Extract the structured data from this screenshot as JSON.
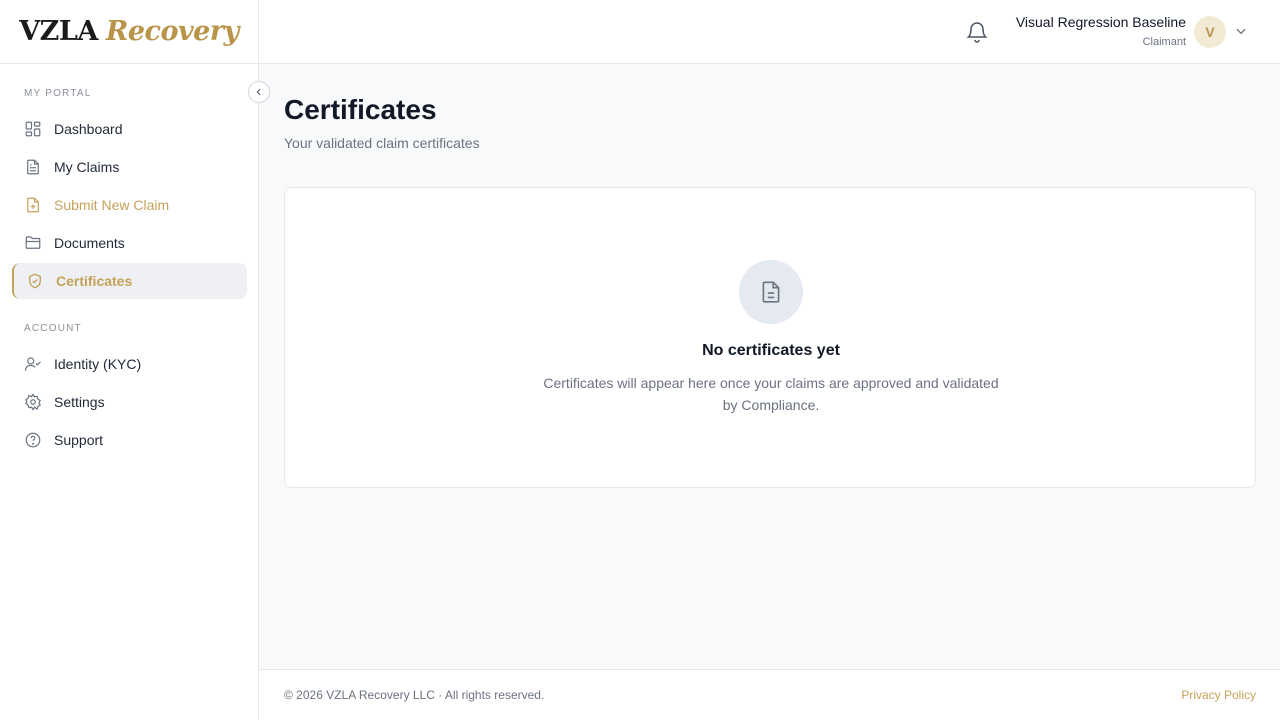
{
  "brand": {
    "part1": "VZLA",
    "part2": "Recovery"
  },
  "sidebar": {
    "section_portal": "MY PORTAL",
    "section_account": "ACCOUNT",
    "items": [
      {
        "label": "Dashboard",
        "icon": "grid-icon"
      },
      {
        "label": "My Claims",
        "icon": "document-icon"
      },
      {
        "label": "Submit New Claim",
        "icon": "file-plus-icon"
      },
      {
        "label": "Documents",
        "icon": "folder-icon"
      },
      {
        "label": "Certificates",
        "icon": "shield-check-icon"
      },
      {
        "label": "Identity (KYC)",
        "icon": "user-check-icon"
      },
      {
        "label": "Settings",
        "icon": "gear-icon"
      },
      {
        "label": "Support",
        "icon": "help-circle-icon"
      }
    ]
  },
  "header": {
    "user_name": "Visual Regression Baseline",
    "user_role": "Claimant",
    "avatar_initial": "V"
  },
  "main": {
    "title": "Certificates",
    "subtitle": "Your validated claim certificates",
    "empty_title": "No certificates yet",
    "empty_desc": "Certificates will appear here once your claims are approved and validated by Compliance."
  },
  "footer": {
    "copyright": "© 2026 VZLA Recovery LLC · All rights reserved.",
    "privacy": "Privacy Policy"
  },
  "colors": {
    "accent": "#c4a25a",
    "text": "#111827",
    "muted": "#6b7280"
  }
}
